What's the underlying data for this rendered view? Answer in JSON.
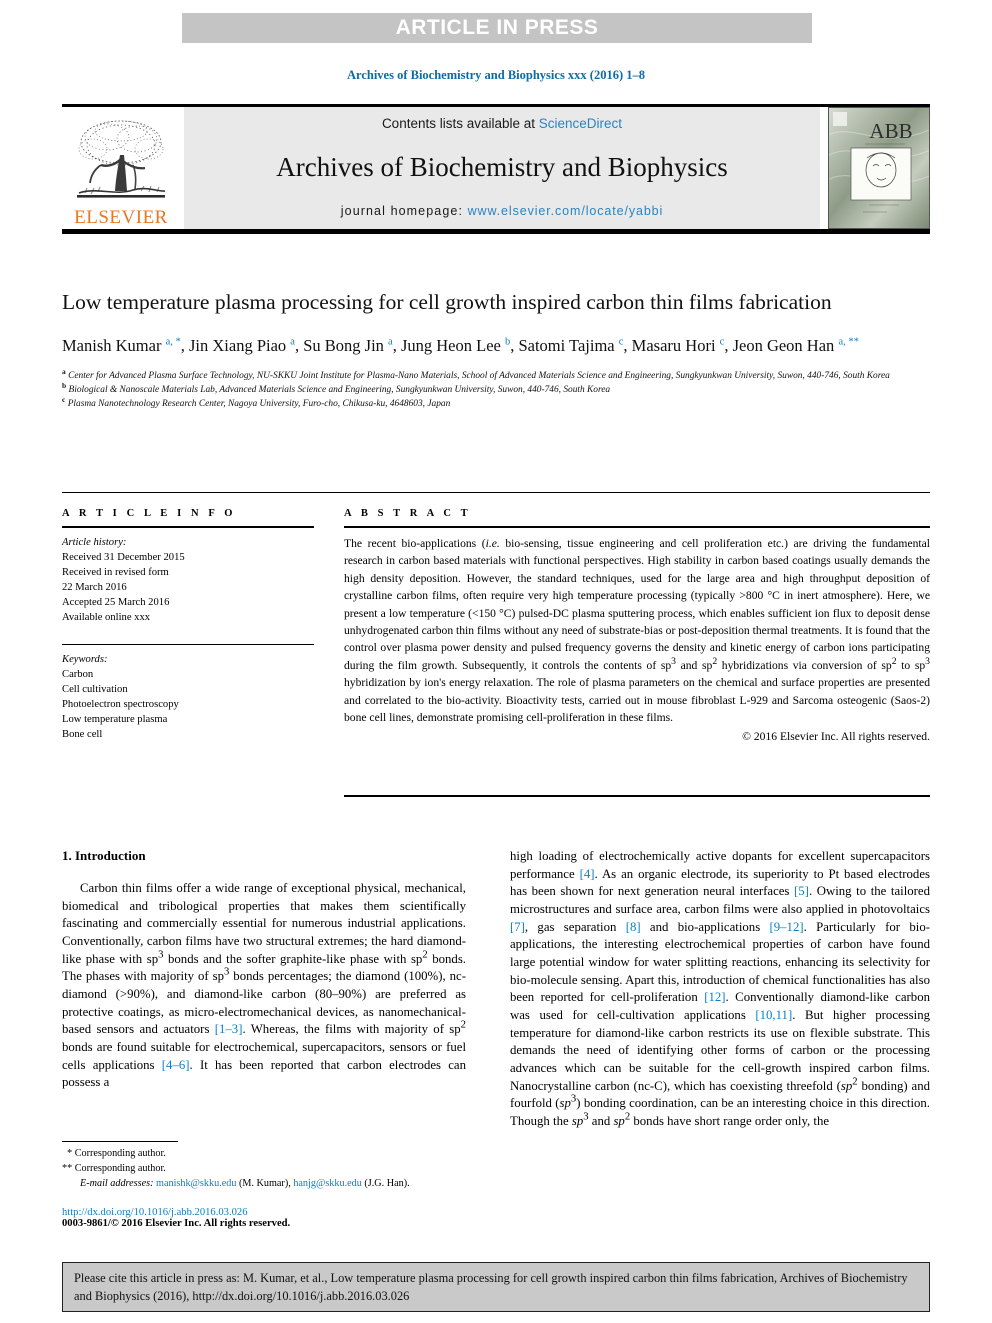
{
  "banner": {
    "label": "ARTICLE IN PRESS"
  },
  "running_head": "Archives of Biochemistry and Biophysics xxx (2016) 1–8",
  "masthead": {
    "contents_prefix": "Contents lists available at ",
    "contents_link": "ScienceDirect",
    "journal_title": "Archives of Biochemistry and Biophysics",
    "homepage_prefix": "journal homepage: ",
    "homepage_link": "www.elsevier.com/locate/yabbi",
    "publisher_logo_word": "ELSEVIER",
    "cover_title": "ABB",
    "cover_subtitle": "Archives of Biochemistry and Biophysics"
  },
  "article": {
    "title": "Low temperature plasma processing for cell growth inspired carbon thin films fabrication",
    "authors_html": "Manish Kumar <sup>a, *</sup>, Jin Xiang Piao <sup>a</sup>, Su Bong Jin <sup>a</sup>, Jung Heon Lee <sup>b</sup>, Satomi Tajima <sup>c</sup>, Masaru Hori <sup>c</sup>, Jeon Geon Han <sup>a, **</sup>",
    "affiliation_a": "Center for Advanced Plasma Surface Technology, NU-SKKU Joint Institute for Plasma-Nano Materials, School of Advanced Materials Science and Engineering, Sungkyunkwan University, Suwon, 440-746, South Korea",
    "affiliation_b": "Biological & Nanoscale Materials Lab, Advanced Materials Science and Engineering, Sungkyunkwan University, Suwon, 440-746, South Korea",
    "affiliation_c": "Plasma Nanotechnology Research Center, Nagoya University, Furo-cho, Chikusa-ku, 4648603, Japan"
  },
  "article_info": {
    "heading": "A R T I C L E   I N F O",
    "history_label": "Article history:",
    "history": [
      "Received 31 December 2015",
      "Received in revised form",
      "22 March 2016",
      "Accepted 25 March 2016",
      "Available online xxx"
    ],
    "keywords_label": "Keywords:",
    "keywords": [
      "Carbon",
      "Cell cultivation",
      "Photoelectron spectroscopy",
      "Low temperature plasma",
      "Bone cell"
    ]
  },
  "abstract": {
    "heading": "A B S T R A C T",
    "body_html": "The recent bio-applications (<i>i.e.</i> bio-sensing, tissue engineering and cell proliferation etc.) are driving the fundamental research in carbon based materials with functional perspectives. High stability in carbon based coatings usually demands the high density deposition. However, the standard techniques, used for the large area and high throughput deposition of crystalline carbon films, often require very high temperature processing (typically &gt;800 &deg;C in inert atmosphere). Here, we present a low temperature (&lt;150 &deg;C) pulsed-DC plasma sputtering process, which enables sufficient ion flux to deposit dense unhydrogenated carbon thin films without any need of substrate-bias or post-deposition thermal treatments. It is found that the control over plasma power density and pulsed frequency governs the density and kinetic energy of carbon ions participating during the film growth. Subsequently, it controls the contents of sp<sup>3</sup> and sp<sup>2</sup> hybridizations via conversion of sp<sup>2</sup> to sp<sup>3</sup> hybridization by ion's energy relaxation. The role of plasma parameters on the chemical and surface properties are presented and correlated to the bio-activity. Bioactivity tests, carried out in mouse fibroblast L-929 and Sarcoma osteogenic (Saos-2) bone cell lines, demonstrate promising cell-proliferation in these films.",
    "copyright": "© 2016 Elsevier Inc. All rights reserved."
  },
  "body": {
    "section_number_title": "1.  Introduction",
    "left_paragraph_html": "Carbon thin films offer a wide range of exceptional physical, mechanical, biomedical and tribological properties that makes them scientifically fascinating and commercially essential for numerous industrial applications. Conventionally, carbon films have two structural extremes; the hard diamond-like phase with sp<sup>3</sup> bonds and the softer graphite-like phase with sp<sup>2</sup> bonds. The phases with majority of sp<sup>3</sup> bonds percentages; the diamond (100%), nc-diamond (&gt;90%), and diamond-like carbon (80&ndash;90%) are preferred as protective coatings, as micro-electromechanical devices, as nanomechanical-based sensors and actuators <span class=\"ref\">[1&ndash;3]</span>. Whereas, the films with majority of sp<sup>2</sup> bonds are found suitable for electrochemical, supercapacitors, sensors or fuel cells applications <span class=\"ref\">[4&ndash;6]</span>. It has been reported that carbon electrodes can possess a",
    "right_paragraph_html": "high loading of electrochemically active dopants for excellent supercapacitors performance <span class=\"ref\">[4]</span>. As an organic electrode, its superiority to Pt based electrodes has been shown for next generation neural interfaces <span class=\"ref\">[5]</span>. Owing to the tailored microstructures and surface area, carbon films were also applied in photovoltaics <span class=\"ref\">[7]</span>, gas separation <span class=\"ref\">[8]</span> and bio-applications <span class=\"ref\">[9&ndash;12]</span>. Particularly for bio-applications, the interesting electrochemical properties of carbon have found large potential window for water splitting reactions, enhancing its selectivity for bio-molecule sensing. Apart this, introduction of chemical functionalities has also been reported for cell-proliferation <span class=\"ref\">[12]</span>. Conventionally diamond-like carbon was used for cell-cultivation applications <span class=\"ref\">[10,11]</span>. But higher processing temperature for diamond-like carbon restricts its use on flexible substrate. This demands the need of identifying other forms of carbon or the processing advances which can be suitable for the cell-growth inspired carbon films. Nanocrystalline carbon (nc-C), which has coexisting threefold (<i>sp</i><sup>2</sup> bonding) and fourfold (<i>sp</i><sup>3</sup>) bonding coordination, can be an interesting choice in this direction. Though the <i>sp</i><sup>3</sup> and <i>sp</i><sup>2</sup> bonds have short range order only, the"
  },
  "footnotes": {
    "corresponding_1": "Corresponding author.",
    "corresponding_2": "Corresponding author.",
    "email_label": "E-mail addresses:",
    "email_1": "manishk@skku.edu",
    "email_1_owner": "(M. Kumar)",
    "email_2": "hanjg@skku.edu",
    "email_2_owner": "(J.G. Han)",
    "doi": "http://dx.doi.org/10.1016/j.abb.2016.03.026",
    "issn_line": "0003-9861/© 2016 Elsevier Inc. All rights reserved."
  },
  "citation_box": {
    "text": "Please cite this article in press as: M. Kumar, et al., Low temperature plasma processing for cell growth inspired carbon thin films fabrication, Archives of Biochemistry and Biophysics (2016), http://dx.doi.org/10.1016/j.abb.2016.03.026"
  },
  "colors": {
    "banner_gray": "#c4c4c4",
    "link_blue": "#0b7fc4",
    "elsevier_orange": "#e87722",
    "contents_gray": "#e9e9e9",
    "citation_gray": "#c9c9c9"
  }
}
